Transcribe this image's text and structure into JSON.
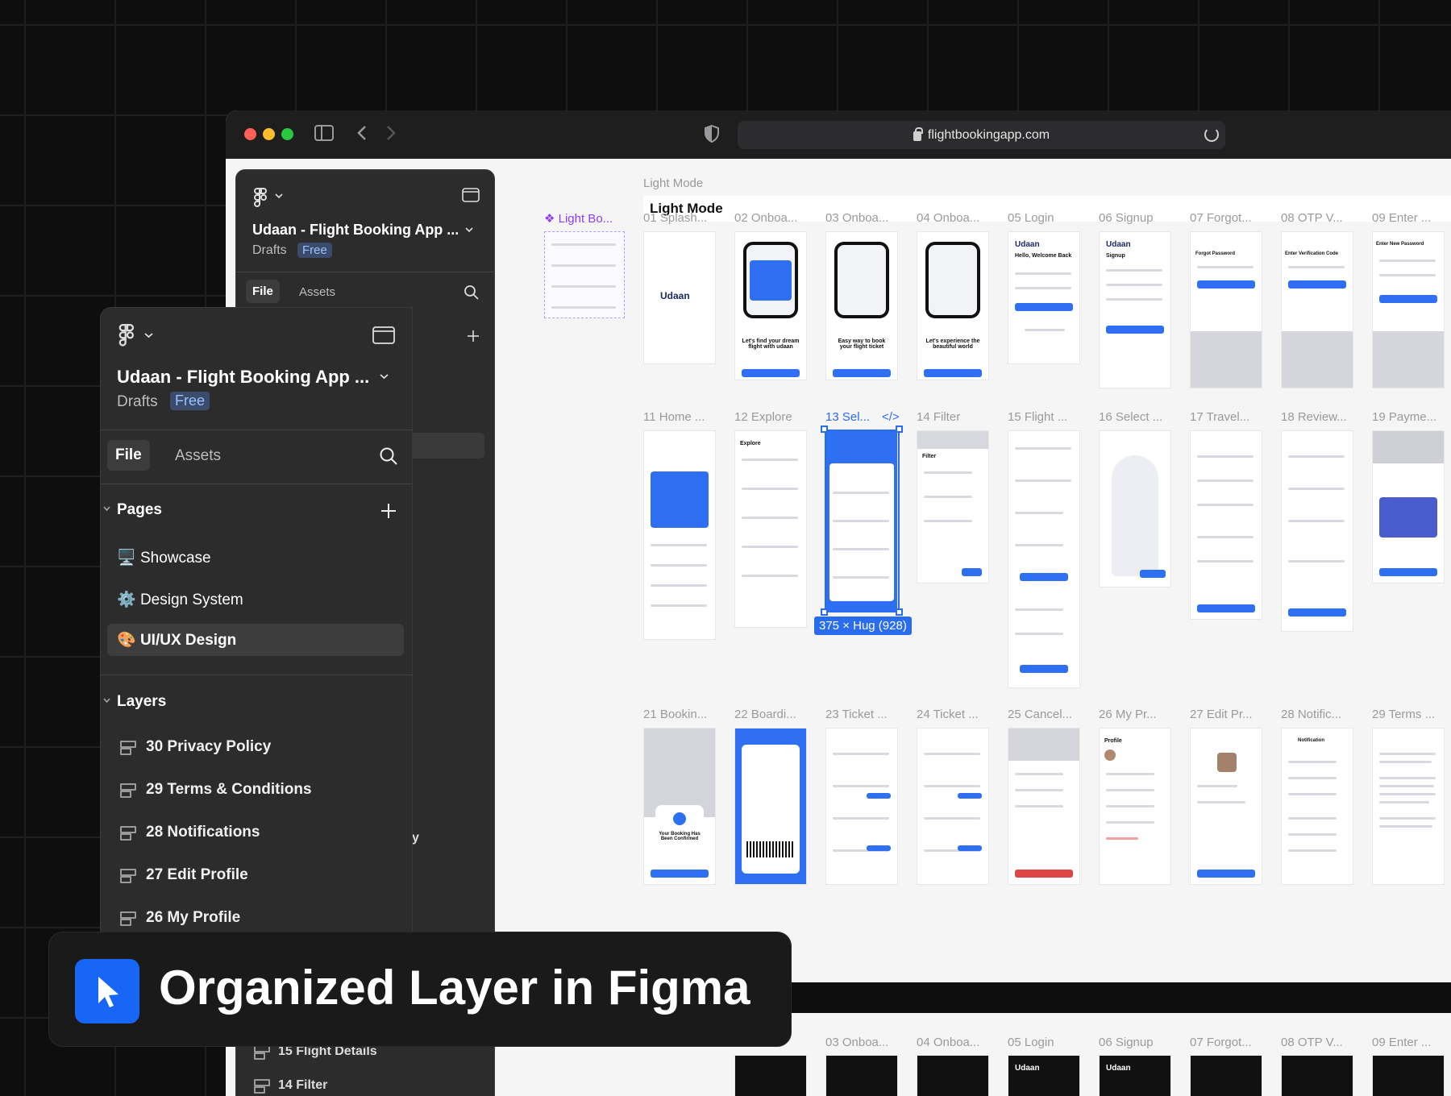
{
  "browser": {
    "url": "flightbookingapp.com"
  },
  "canvas": {
    "section_label": "Light Mode",
    "section_title": "Light Mode",
    "component_label": "❖ Light Bo...",
    "row1": [
      "01 Splash...",
      "02 Onboa...",
      "03 Onboa...",
      "04 Onboa...",
      "05 Login",
      "06 Signup",
      "07 Forgot...",
      "08 OTP V...",
      "09 Enter ..."
    ],
    "row2": [
      "11 Home ...",
      "12 Explore",
      "13 Sel...",
      "14 Filter",
      "15 Flight ...",
      "16 Select ...",
      "17 Travel...",
      "18 Review...",
      "19 Payme..."
    ],
    "row3": [
      "21 Bookin...",
      "22 Boardi...",
      "23 Ticket ...",
      "24 Ticket ...",
      "25 Cancel...",
      "26 My Pr...",
      "27 Edit Pr...",
      "28 Notific...",
      "29 Terms ..."
    ],
    "row4": [
      "03 Onboa...",
      "04 Onboa...",
      "05 Login",
      "06 Signup",
      "07 Forgot...",
      "08 OTP V...",
      "09 Enter ..."
    ],
    "code_icon": "</>",
    "selection_size": "375 × Hug (928)",
    "frame_texts": {
      "udaan": "Udaan",
      "welcome": "Hello, Welcome Back",
      "signup": "Signup",
      "forgot": "Forgot Password",
      "otp": "Enter Verification Code",
      "newpw": "Enter New Password",
      "onb2": "Let's find your dream flight with udaan",
      "onb3": "Easy way to book your flight ticket",
      "onb4": "Let's experience the beautiful world",
      "confirmed": "Your Booking Has Been Confirmed",
      "explore": "Explore",
      "filter": "Filter",
      "profile": "Profile",
      "notification": "Notification"
    }
  },
  "panel_back": {
    "title": "Udaan - Flight Booking App ...",
    "drafts": "Drafts",
    "badge": "Free",
    "tab_file": "File",
    "tab_assets": "Assets",
    "layer_15": "15 Flight Details",
    "layer_14": "14 Filter",
    "partial": "y"
  },
  "panel_front": {
    "title": "Udaan - Flight Booking App ...",
    "drafts": "Drafts",
    "badge": "Free",
    "tab_file": "File",
    "tab_assets": "Assets",
    "pages_heading": "Pages",
    "pages": [
      {
        "icon": "🖥️",
        "label": "Showcase"
      },
      {
        "icon": "⚙️",
        "label": "Design System"
      },
      {
        "icon": "🎨",
        "label": "UI/UX Design"
      }
    ],
    "layers_heading": "Layers",
    "layers": [
      "30 Privacy Policy",
      "29 Terms & Conditions",
      "28 Notifications",
      "27 Edit Profile",
      "26 My Profile"
    ]
  },
  "banner": {
    "text": "Organized Layer in Figma"
  },
  "colors": {
    "accent": "#2a6cf0",
    "brand": "#1866f6",
    "panel": "#2c2c2c"
  }
}
